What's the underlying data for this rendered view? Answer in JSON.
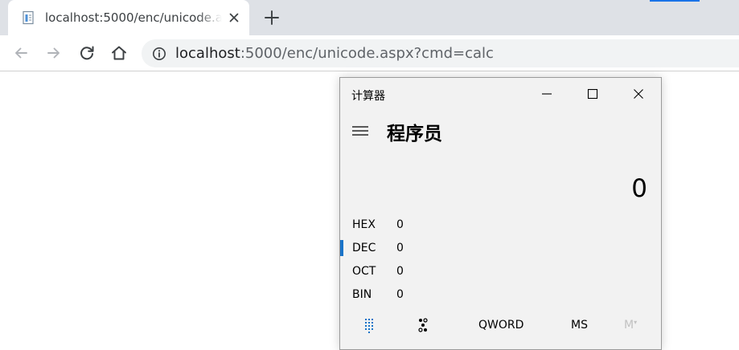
{
  "browser": {
    "tab": {
      "title": "localhost:5000/enc/unicode.aspx?cmd=calc",
      "favicon": "page-icon",
      "close_icon": "close-icon"
    },
    "new_tab_icon": "plus-icon",
    "accent_color": "#1a73e8",
    "toolbar": {
      "back_icon": "arrow-left-icon",
      "forward_icon": "arrow-right-icon",
      "reload_icon": "reload-icon",
      "home_icon": "home-icon",
      "info_icon": "info-icon",
      "url_host": "localhost",
      "url_path": ":5000/enc/unicode.aspx?cmd=calc"
    }
  },
  "calculator": {
    "window_title": "计算器",
    "mode": "程序员",
    "display_value": "0",
    "radix_rows": [
      {
        "label": "HEX",
        "value": "0",
        "selected": false
      },
      {
        "label": "DEC",
        "value": "0",
        "selected": true
      },
      {
        "label": "OCT",
        "value": "0",
        "selected": false
      },
      {
        "label": "BIN",
        "value": "0",
        "selected": false
      }
    ],
    "word_size": "QWORD",
    "memory_store": "MS",
    "memory_dropdown": "M",
    "selected_color": "#1a73c8"
  }
}
